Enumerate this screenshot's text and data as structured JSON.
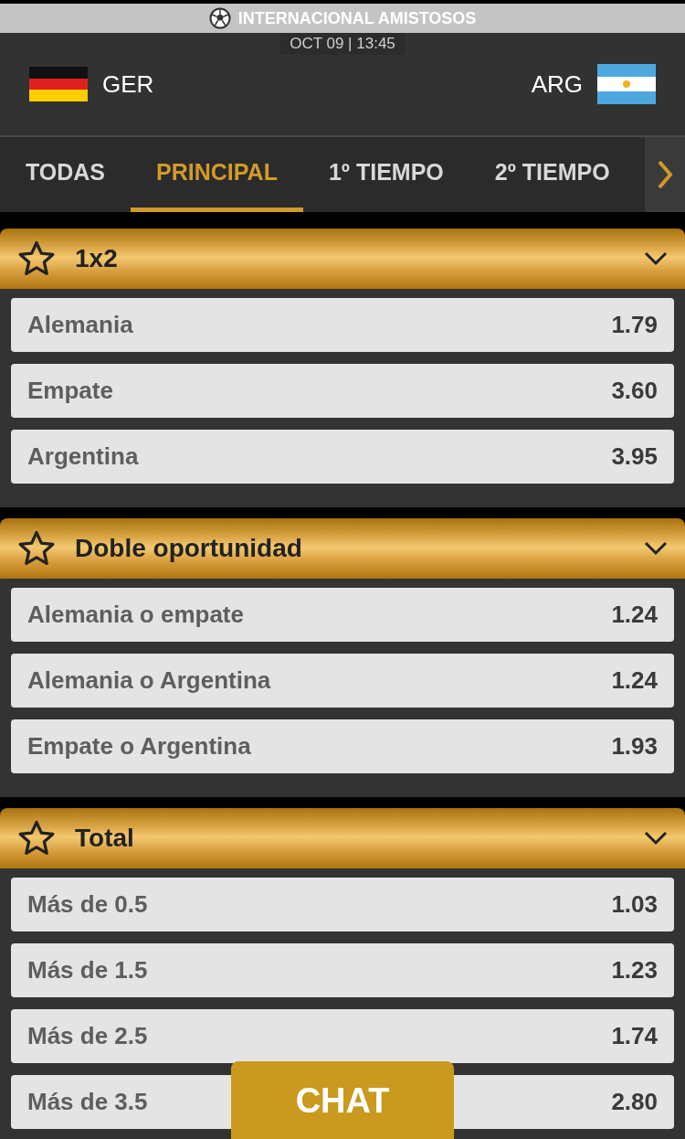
{
  "competition": "INTERNACIONAL AMISTOSOS",
  "datetime": "OCT 09 | 13:45",
  "home": {
    "code": "GER"
  },
  "away": {
    "code": "ARG"
  },
  "tabs": [
    {
      "label": "TODAS",
      "selected": false
    },
    {
      "label": "PRINCIPAL",
      "selected": true
    },
    {
      "label": "1º TIEMPO",
      "selected": false
    },
    {
      "label": "2º TIEMPO",
      "selected": false
    }
  ],
  "markets": [
    {
      "title": "1x2",
      "expanded": true,
      "favorite": false,
      "outcomes": [
        {
          "label": "Alemania",
          "odds": "1.79"
        },
        {
          "label": "Empate",
          "odds": "3.60"
        },
        {
          "label": "Argentina",
          "odds": "3.95"
        }
      ]
    },
    {
      "title": "Doble oportunidad",
      "expanded": true,
      "favorite": false,
      "outcomes": [
        {
          "label": "Alemania o empate",
          "odds": "1.24"
        },
        {
          "label": "Alemania o Argentina",
          "odds": "1.24"
        },
        {
          "label": "Empate o Argentina",
          "odds": "1.93"
        }
      ]
    },
    {
      "title": "Total",
      "expanded": true,
      "favorite": false,
      "outcomes": [
        {
          "label": "Más de 0.5",
          "odds": "1.03"
        },
        {
          "label": "Más de 1.5",
          "odds": "1.23"
        },
        {
          "label": "Más de 2.5",
          "odds": "1.74"
        },
        {
          "label": "Más de 3.5",
          "odds": "2.80"
        }
      ]
    }
  ],
  "chat_button": "CHAT"
}
